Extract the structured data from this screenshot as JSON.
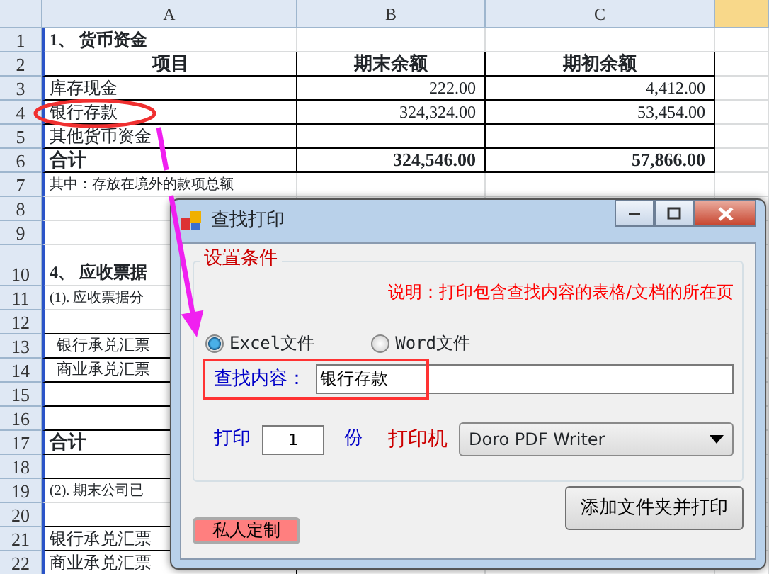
{
  "spreadsheet": {
    "columns": [
      "A",
      "B",
      "C"
    ],
    "rows": [
      {
        "number": "1",
        "kind": "title",
        "a": "1、 货币资金"
      },
      {
        "number": "2",
        "kind": "header",
        "a": "项目",
        "b": "期末余额",
        "c": "期初余额"
      },
      {
        "number": "3",
        "kind": "item",
        "a": "库存现金",
        "b": "222.00",
        "c": "4,412.00"
      },
      {
        "number": "4",
        "kind": "item",
        "a": "银行存款",
        "b": "324,324.00",
        "c": "53,454.00"
      },
      {
        "number": "5",
        "kind": "item",
        "a": "其他货币资金"
      },
      {
        "number": "6",
        "kind": "total",
        "a": "合计",
        "b": "324,546.00",
        "c": "57,866.00"
      },
      {
        "number": "7",
        "kind": "note",
        "a": "其中：存放在境外的款项总额"
      },
      {
        "number": "8",
        "kind": "blank"
      },
      {
        "number": "9",
        "kind": "blank"
      },
      {
        "number": "10",
        "kind": "title",
        "a": "4、 应收票据"
      },
      {
        "number": "11",
        "kind": "note",
        "a": "(1). 应收票据分"
      },
      {
        "number": "12",
        "kind": "header"
      },
      {
        "number": "13",
        "kind": "subitem",
        "a": "银行承兑汇票"
      },
      {
        "number": "14",
        "kind": "subitem",
        "a": "商业承兑汇票"
      },
      {
        "number": "15",
        "kind": "item"
      },
      {
        "number": "16",
        "kind": "item"
      },
      {
        "number": "17",
        "kind": "total",
        "a": "合计"
      },
      {
        "number": "18",
        "kind": "item"
      },
      {
        "number": "19",
        "kind": "note",
        "a": "(2). 期末公司已"
      },
      {
        "number": "20",
        "kind": "header"
      },
      {
        "number": "21",
        "kind": "item",
        "a": "银行承兑汇票"
      },
      {
        "number": "22",
        "kind": "item",
        "a": "商业承兑汇票"
      }
    ]
  },
  "dialog": {
    "title": "查找打印",
    "group_title": "设置条件",
    "note": "说明：打印包含查找内容的表格/文档的所在页",
    "file_types": [
      {
        "label": "Excel文件",
        "selected": true
      },
      {
        "label": "Word文件",
        "selected": false
      }
    ],
    "search_label": "查找内容：",
    "search_value": "银行存款",
    "copies_label": "打印",
    "copies_value": "1",
    "copies_unit": "份",
    "printer_label": "打印机",
    "printer_value": "Doro PDF Writer",
    "custom_button": "私人定制",
    "print_button": "添加文件夹并打印"
  }
}
